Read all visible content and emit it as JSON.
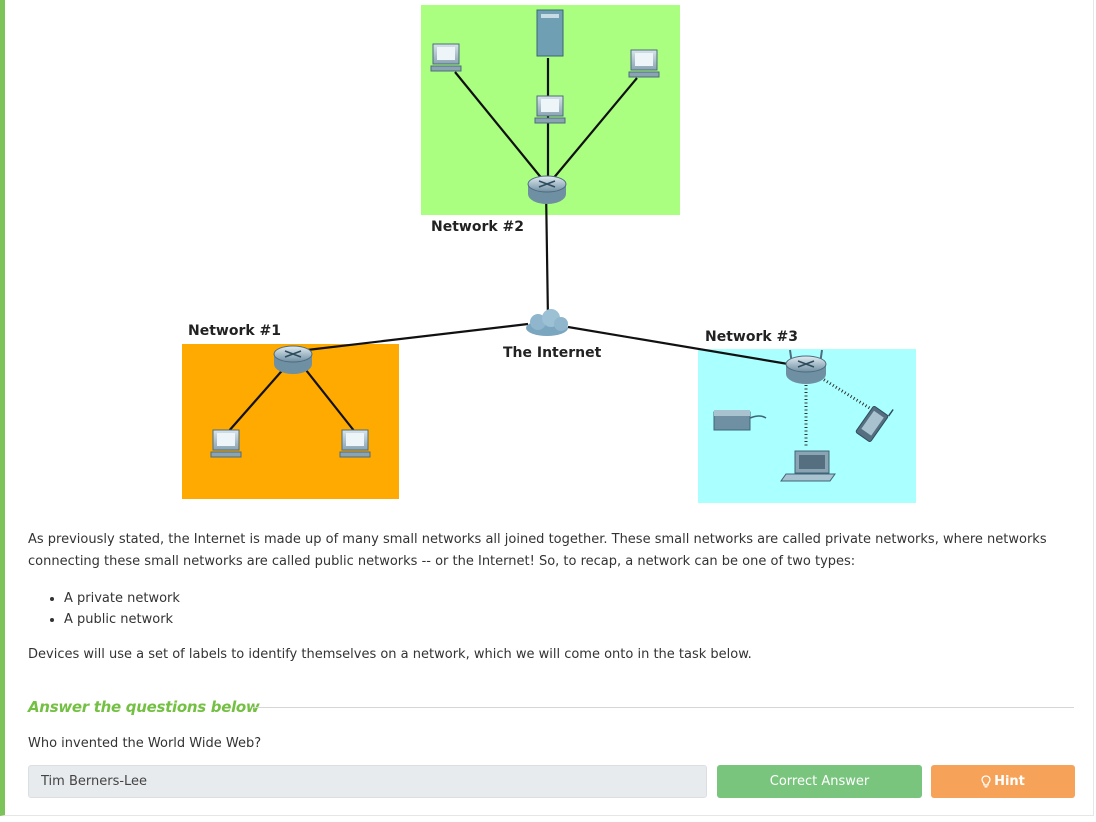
{
  "diagram": {
    "network2_label": "Network #2",
    "network1_label": "Network #1",
    "network3_label": "Network #3",
    "internet_label": "The Internet",
    "colors": {
      "network1": "#ffaa00",
      "network2": "#aaff80",
      "network3": "#aaffff"
    }
  },
  "content": {
    "paragraph1": "As previously stated, the Internet is made up of many small networks all joined together.  These small networks are called private networks, where networks connecting these small networks are called public networks -- or the Internet! So, to recap, a network can be one of two types:",
    "types": [
      "A private network",
      "A public network"
    ],
    "paragraph2": "Devices will use a set of labels to identify themselves on a network, which we will come onto in the task below."
  },
  "questions": {
    "heading": "Answer the questions below",
    "question": "Who invented the World Wide Web?",
    "answer": "Tim Berners-Lee",
    "correct_label": "Correct Answer",
    "hint_label": "Hint"
  }
}
